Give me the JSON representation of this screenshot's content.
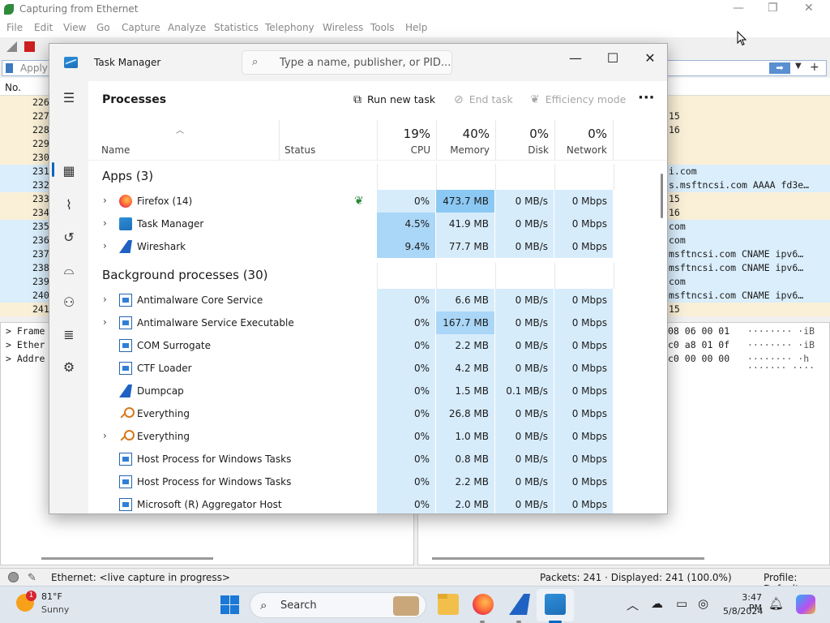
{
  "wireshark": {
    "title": "Capturing from Ethernet",
    "menu": [
      "File",
      "Edit",
      "View",
      "Go",
      "Capture",
      "Analyze",
      "Statistics",
      "Telephony",
      "Wireless",
      "Tools",
      "Help"
    ],
    "filter_placeholder": "Apply",
    "list_header_no": "No.",
    "rows": [
      {
        "no": "226",
        "info": "",
        "color": "y"
      },
      {
        "no": "227",
        "info": "15",
        "color": "y"
      },
      {
        "no": "228",
        "info": "16",
        "color": "y"
      },
      {
        "no": "229",
        "info": "",
        "color": "y"
      },
      {
        "no": "230",
        "info": "",
        "color": "y"
      },
      {
        "no": "231",
        "info": "i.com",
        "color": "b"
      },
      {
        "no": "232",
        "info": "s.msftncsi.com AAAA fd3e…",
        "color": "b"
      },
      {
        "no": "233",
        "info": "15",
        "color": "y"
      },
      {
        "no": "234",
        "info": "16",
        "color": "y"
      },
      {
        "no": "235",
        "info": "com",
        "color": "b"
      },
      {
        "no": "236",
        "info": "com",
        "color": "b"
      },
      {
        "no": "237",
        "info": "msftncsi.com CNAME ipv6…",
        "color": "b"
      },
      {
        "no": "238",
        "info": "msftncsi.com CNAME ipv6…",
        "color": "b"
      },
      {
        "no": "239",
        "info": "com",
        "color": "b"
      },
      {
        "no": "240",
        "info": "msftncsi.com CNAME ipv6…",
        "color": "b"
      },
      {
        "no": "241",
        "info": "15",
        "color": "y"
      }
    ],
    "detail": [
      "Frame",
      "Ether",
      "Addre"
    ],
    "bytes_hex": [
      "08 06 00 01",
      "c0 a8 01 0f",
      "c0 00 00 00"
    ],
    "bytes_ascii": [
      "········ ·iB",
      "········ ·iB",
      "········ ·h",
      "······· ····"
    ],
    "status_left": "Ethernet: <live capture in progress>",
    "status_packets": "Packets: 241 · Displayed: 241 (100.0%)",
    "status_profile": "Profile: Default"
  },
  "taskmanager": {
    "title": "Task Manager",
    "search_placeholder": "Type a name, publisher, or PID...",
    "page_title": "Processes",
    "commands": {
      "run": "Run new task",
      "end": "End task",
      "efficiency": "Efficiency mode",
      "more": "···"
    },
    "columns": {
      "name": "Name",
      "status": "Status",
      "cpu": {
        "pct": "19%",
        "label": "CPU"
      },
      "memory": {
        "pct": "40%",
        "label": "Memory"
      },
      "disk": {
        "pct": "0%",
        "label": "Disk"
      },
      "network": {
        "pct": "0%",
        "label": "Network"
      }
    },
    "groups": {
      "apps": "Apps (3)",
      "background": "Background processes (30)"
    },
    "apps": [
      {
        "name": "Firefox (14)",
        "icon": "firefox-icon",
        "expand": true,
        "eco": true,
        "cpu": "0%",
        "mem": "473.7 MB",
        "disk": "0 MB/s",
        "net": "0 Mbps"
      },
      {
        "name": "Task Manager",
        "icon": "task-manager-icon",
        "expand": true,
        "eco": false,
        "cpu": "4.5%",
        "mem": "41.9 MB",
        "disk": "0 MB/s",
        "net": "0 Mbps"
      },
      {
        "name": "Wireshark",
        "icon": "wireshark-icon",
        "expand": true,
        "eco": false,
        "cpu": "9.4%",
        "mem": "77.7 MB",
        "disk": "0 MB/s",
        "net": "0 Mbps"
      }
    ],
    "background": [
      {
        "name": "Antimalware Core Service",
        "icon": "service-icon",
        "expand": true,
        "cpu": "0%",
        "mem": "6.6 MB",
        "disk": "0 MB/s",
        "net": "0 Mbps"
      },
      {
        "name": "Antimalware Service Executable",
        "icon": "service-icon",
        "expand": true,
        "cpu": "0%",
        "mem": "167.7 MB",
        "disk": "0 MB/s",
        "net": "0 Mbps"
      },
      {
        "name": "COM Surrogate",
        "icon": "service-icon",
        "expand": false,
        "cpu": "0%",
        "mem": "2.2 MB",
        "disk": "0 MB/s",
        "net": "0 Mbps"
      },
      {
        "name": "CTF Loader",
        "icon": "service-icon",
        "expand": false,
        "cpu": "0%",
        "mem": "4.2 MB",
        "disk": "0 MB/s",
        "net": "0 Mbps"
      },
      {
        "name": "Dumpcap",
        "icon": "wireshark-icon",
        "expand": false,
        "cpu": "0%",
        "mem": "1.5 MB",
        "disk": "0.1 MB/s",
        "net": "0 Mbps"
      },
      {
        "name": "Everything",
        "icon": "key-icon",
        "expand": false,
        "cpu": "0%",
        "mem": "26.8 MB",
        "disk": "0 MB/s",
        "net": "0 Mbps"
      },
      {
        "name": "Everything",
        "icon": "key-icon",
        "expand": true,
        "cpu": "0%",
        "mem": "1.0 MB",
        "disk": "0 MB/s",
        "net": "0 Mbps"
      },
      {
        "name": "Host Process for Windows Tasks",
        "icon": "service-icon",
        "expand": false,
        "cpu": "0%",
        "mem": "0.8 MB",
        "disk": "0 MB/s",
        "net": "0 Mbps"
      },
      {
        "name": "Host Process for Windows Tasks",
        "icon": "service-icon",
        "expand": false,
        "cpu": "0%",
        "mem": "2.2 MB",
        "disk": "0 MB/s",
        "net": "0 Mbps"
      },
      {
        "name": "Microsoft (R) Aggregator Host",
        "icon": "service-icon",
        "expand": false,
        "cpu": "0%",
        "mem": "2.0 MB",
        "disk": "0 MB/s",
        "net": "0 Mbps"
      }
    ]
  },
  "taskbar": {
    "weather_badge": "1",
    "temperature": "81°F",
    "condition": "Sunny",
    "search_label": "Search",
    "time": "3:47 PM",
    "date": "5/8/2024"
  },
  "colors": {
    "accent": "#0067c0",
    "heat_low": "#d7ecfb",
    "heat_mid": "#c6e4fa",
    "heat_high": "#aad6f7",
    "heat_max": "#8bc8f3",
    "ws_row_yellow": "#faf0d7",
    "ws_row_blue": "#daeefc"
  }
}
